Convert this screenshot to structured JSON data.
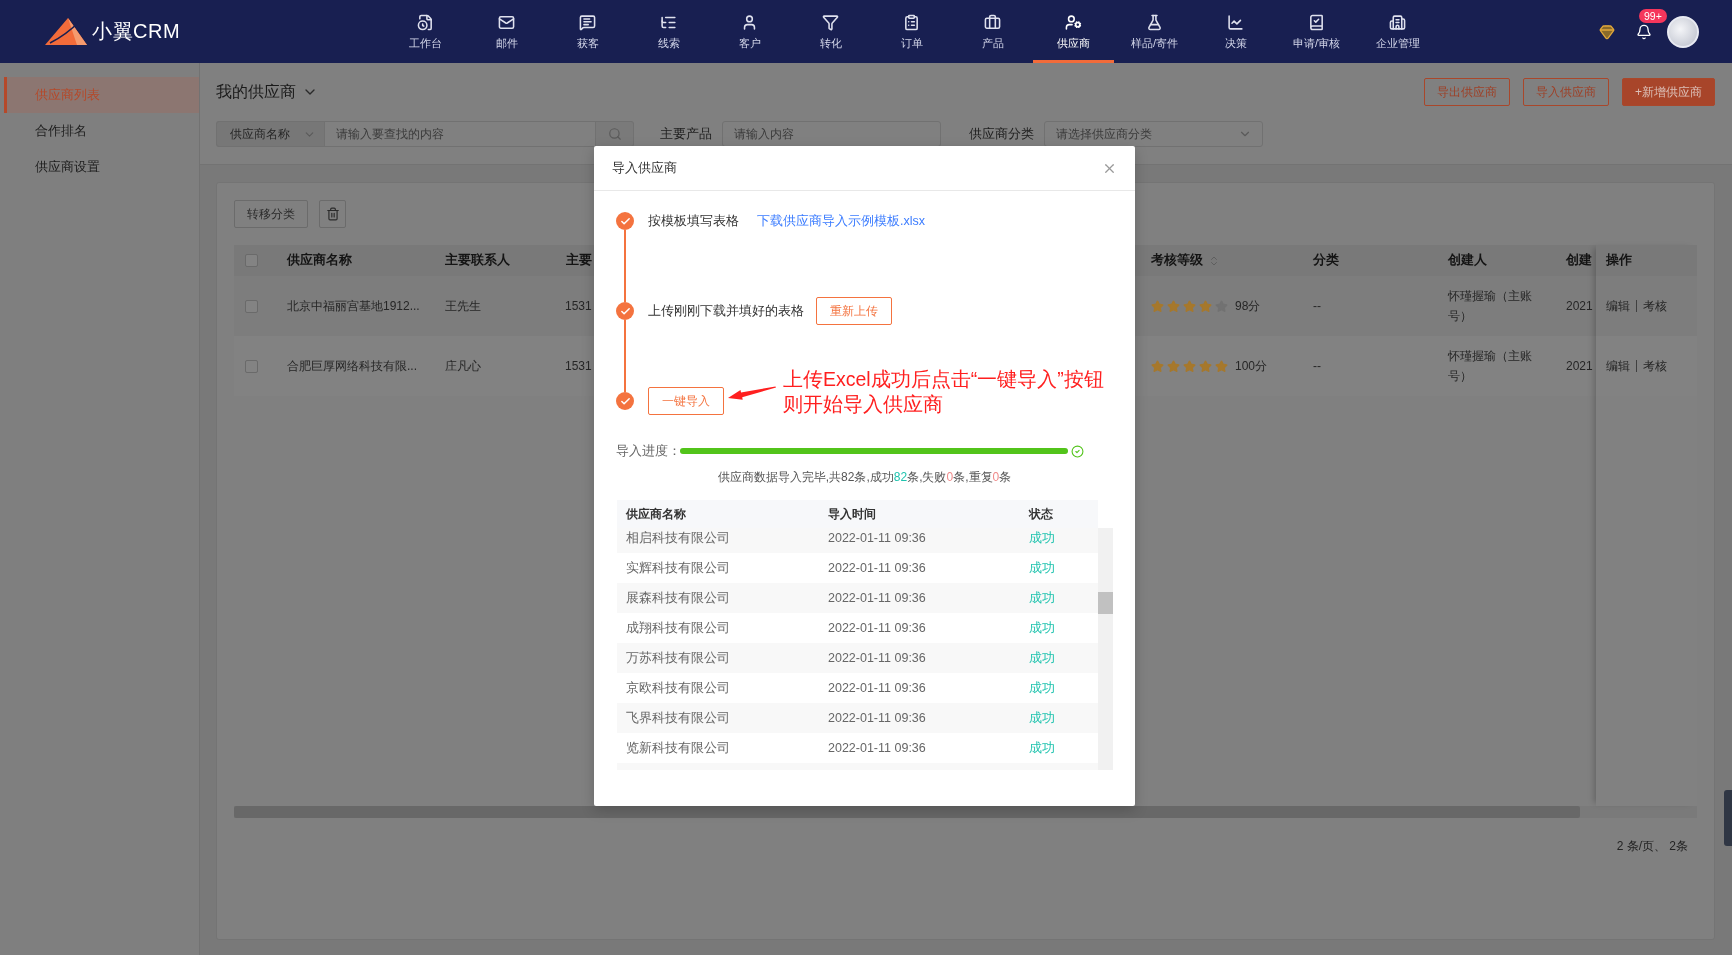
{
  "top_nav": {
    "logo_text": "小翼CRM",
    "items": [
      {
        "label": "工作台",
        "selected": false
      },
      {
        "label": "邮件",
        "selected": false
      },
      {
        "label": "获客",
        "selected": false
      },
      {
        "label": "线索",
        "selected": false
      },
      {
        "label": "客户",
        "selected": false
      },
      {
        "label": "转化",
        "selected": false
      },
      {
        "label": "订单",
        "selected": false
      },
      {
        "label": "产品",
        "selected": false
      },
      {
        "label": "供应商",
        "selected": true
      },
      {
        "label": "样品/寄件",
        "selected": false
      },
      {
        "label": "决策",
        "selected": false
      },
      {
        "label": "申请/审核",
        "selected": false
      },
      {
        "label": "企业管理",
        "selected": false
      }
    ],
    "notification_badge": "99+"
  },
  "sidebar": {
    "items": [
      {
        "label": "供应商列表",
        "selected": true
      },
      {
        "label": "合作排名",
        "selected": false
      },
      {
        "label": "供应商设置",
        "selected": false
      }
    ]
  },
  "page_header": {
    "title": "我的供应商",
    "buttons": [
      {
        "label": "导出供应商",
        "kind": "outline"
      },
      {
        "label": "导入供应商",
        "kind": "outline"
      },
      {
        "label": "+新增供应商",
        "kind": "primary"
      }
    ]
  },
  "filters": {
    "search_scope": "供应商名称",
    "search_placeholder": "请输入要查找的内容",
    "fields": [
      {
        "label": "主要产品",
        "placeholder": "请输入内容",
        "kind": "input"
      },
      {
        "label": "供应商分类",
        "placeholder": "请选择供应商分类",
        "kind": "select"
      }
    ]
  },
  "toolbar": {
    "move_button": "转移分类"
  },
  "table": {
    "all_checked": false,
    "columns": [
      {
        "label": "供应商名称",
        "sortable": false
      },
      {
        "label": "主要联系人",
        "sortable": false
      },
      {
        "label": "主要",
        "sortable": false
      },
      {
        "label": "考核等级",
        "sortable": true
      },
      {
        "label": "分类",
        "sortable": false
      },
      {
        "label": "创建人",
        "sortable": false
      },
      {
        "label": "创建",
        "sortable": false
      },
      {
        "label": "操作",
        "sortable": false
      }
    ],
    "rows": [
      {
        "checked": false,
        "name": "北京中福丽宫基地1912...",
        "contact": "王先生",
        "phone": "1531",
        "stars": 4,
        "score": "98分",
        "category": "--",
        "creator": "怀瑾握瑜（主账号）",
        "created": "2021",
        "actions": [
          "编辑",
          "考核"
        ]
      },
      {
        "checked": false,
        "name": "合肥巨厚网络科技有限...",
        "contact": "庄凡心",
        "phone": "1531",
        "stars": 5,
        "score": "100分",
        "category": "--",
        "creator": "怀瑾握瑜（主账号）",
        "created": "2021",
        "actions": [
          "编辑",
          "考核"
        ]
      }
    ]
  },
  "pagination": "2 条/页、 2条",
  "import_dialog": {
    "title": "导入供应商",
    "steps": [
      {
        "kind": "link",
        "label": "按模板填写表格",
        "action": "下载供应商导入示例模板.xlsx",
        "done": true
      },
      {
        "kind": "button",
        "label": "上传刚刚下载并填好的表格",
        "action": "重新上传",
        "done": true
      },
      {
        "kind": "button",
        "action": "一键导入",
        "done": true
      }
    ],
    "annotation": [
      "上传Excel成功后点击“一键导入”按钮",
      "则开始导入供应商"
    ],
    "progress": {
      "label": "导入进度：",
      "level": 1,
      "complete": true
    },
    "summary": [
      {
        "text": "供应商数据导入完毕,共82条,成功",
        "kind": "plain"
      },
      {
        "text": "82",
        "kind": "success"
      },
      {
        "text": "条,失败",
        "kind": "plain"
      },
      {
        "text": "0",
        "kind": "fail"
      },
      {
        "text": "条,重复",
        "kind": "plain"
      },
      {
        "text": "0",
        "kind": "fail"
      },
      {
        "text": "条",
        "kind": "plain"
      }
    ],
    "table": {
      "columns": [
        "供应商名称",
        "导入时间",
        "状态"
      ],
      "rows": [
        {
          "name": "相启科技有限公司",
          "time": "2022-01-11 09:36",
          "status": "成功",
          "kind": "success"
        },
        {
          "name": "实辉科技有限公司",
          "time": "2022-01-11 09:36",
          "status": "成功",
          "kind": "success"
        },
        {
          "name": "展森科技有限公司",
          "time": "2022-01-11 09:36",
          "status": "成功",
          "kind": "success"
        },
        {
          "name": "成翔科技有限公司",
          "time": "2022-01-11 09:36",
          "status": "成功",
          "kind": "success"
        },
        {
          "name": "万苏科技有限公司",
          "time": "2022-01-11 09:36",
          "status": "成功",
          "kind": "success"
        },
        {
          "name": "京欧科技有限公司",
          "time": "2022-01-11 09:36",
          "status": "成功",
          "kind": "success"
        },
        {
          "name": "飞界科技有限公司",
          "time": "2022-01-11 09:36",
          "status": "成功",
          "kind": "success"
        },
        {
          "name": "览新科技有限公司",
          "time": "2022-01-11 09:36",
          "status": "成功",
          "kind": "success"
        }
      ]
    }
  }
}
